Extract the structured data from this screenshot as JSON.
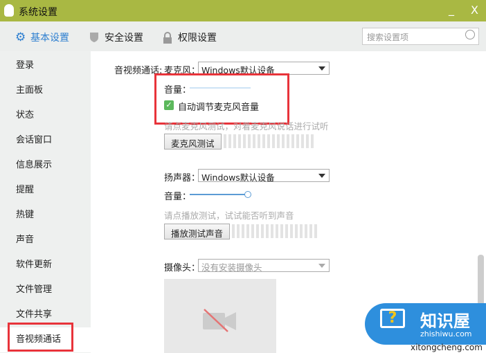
{
  "window": {
    "title": "系统设置",
    "minimize": "_",
    "close": "X"
  },
  "tabs": [
    {
      "label": "基本设置",
      "icon": "gear-icon",
      "active": true
    },
    {
      "label": "安全设置",
      "icon": "shield-icon"
    },
    {
      "label": "权限设置",
      "icon": "lock-icon"
    }
  ],
  "search": {
    "placeholder": "搜索设置项"
  },
  "sidebar": {
    "items": [
      "登录",
      "主面板",
      "状态",
      "会话窗口",
      "信息展示",
      "提醒",
      "热键",
      "声音",
      "软件更新",
      "文件管理",
      "文件共享",
      "音视频通话"
    ],
    "selected": "音视频通话"
  },
  "av": {
    "section_label": "音视频通话:",
    "mic_label": "麦克风：",
    "mic_value": "Windows默认设备",
    "mic_volume_label": "音量：",
    "auto_adjust_label": "自动调节麦克风音量",
    "auto_adjust_checked": true,
    "mic_hint": "请点麦克风测试，对着麦克风说话进行试听",
    "mic_test_button": "麦克风测试",
    "speaker_label": "扬声器：",
    "speaker_value": "Windows默认设备",
    "speaker_volume_label": "音量：",
    "speaker_volume_percent": 100,
    "speaker_hint": "请点播放测试，试试能否听到声音",
    "speaker_test_button": "播放测试声音",
    "camera_label": "摄像头：",
    "camera_value": "没有安装摄像头"
  },
  "watermark": {
    "title": "知识屋",
    "url": "zhishiwu.com",
    "url2": "xitongcheng.com"
  },
  "colors": {
    "titlebar": "#a9b843",
    "accent": "#2e7fd0",
    "highlight": "#e8333a"
  }
}
